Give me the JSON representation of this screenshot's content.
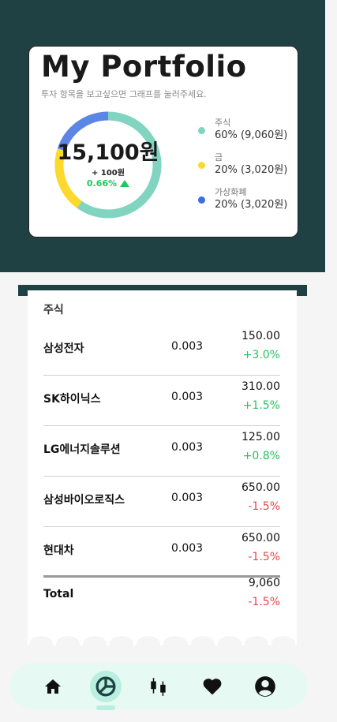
{
  "header": {
    "title": "My Portfolio",
    "subtitle": "투자 항목을 보고싶으면 그래프를 눌러주세요."
  },
  "summary": {
    "total": "15,100원",
    "delta": "+ 100원",
    "delta_pct": "0.66%"
  },
  "chart_data": {
    "type": "pie",
    "donut": true,
    "categories": [
      "주식",
      "금",
      "가상화폐"
    ],
    "values": [
      60,
      20,
      20
    ],
    "amounts": [
      "9,060원",
      "3,020원",
      "3,020원"
    ],
    "colors": [
      "#80d4c0",
      "#fcd92b",
      "#5b86e5"
    ]
  },
  "legend": [
    {
      "name": "주식",
      "value": "60% (9,060원)",
      "color": "#80d4c0"
    },
    {
      "name": "금",
      "value": "20% (3,020원)",
      "color": "#fcd92b"
    },
    {
      "name": "가상화폐",
      "value": "20% (3,020원)",
      "color": "#3b6ee0"
    }
  ],
  "stocks": {
    "section_title": "주식",
    "rows": [
      {
        "name": "삼성전자",
        "qty": "0.003",
        "price": "150.00",
        "change": "+3.0%",
        "dir": "pos"
      },
      {
        "name": "SK하이닉스",
        "qty": "0.003",
        "price": "310.00",
        "change": "+1.5%",
        "dir": "pos"
      },
      {
        "name": "LG에너지솔루션",
        "qty": "0.003",
        "price": "125.00",
        "change": "+0.8%",
        "dir": "pos"
      },
      {
        "name": "삼성바이오로직스",
        "qty": "0.003",
        "price": "650.00",
        "change": "-1.5%",
        "dir": "neg"
      },
      {
        "name": "현대차",
        "qty": "0.003",
        "price": "650.00",
        "change": "-1.5%",
        "dir": "neg"
      }
    ],
    "total_label": "Total",
    "total_value": "9,060",
    "total_change": "-1.5%"
  },
  "nav": {
    "items": [
      {
        "icon": "home-icon",
        "active": false
      },
      {
        "icon": "pie-chart-icon",
        "active": true
      },
      {
        "icon": "candlestick-icon",
        "active": false
      },
      {
        "icon": "heart-icon",
        "active": false
      },
      {
        "icon": "user-icon",
        "active": false
      }
    ]
  }
}
